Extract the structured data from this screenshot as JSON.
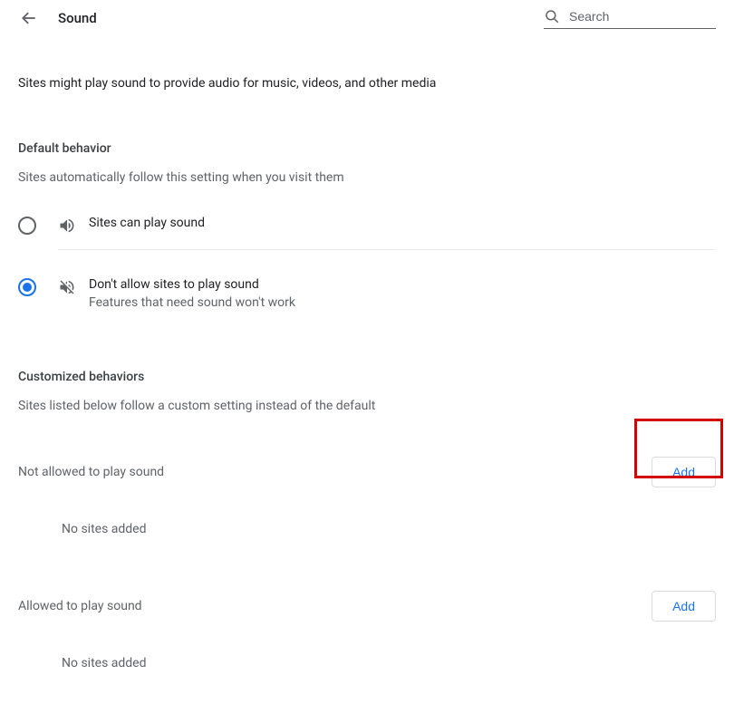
{
  "header": {
    "title": "Sound",
    "search_placeholder": "Search"
  },
  "intro": "Sites might play sound to provide audio for music, videos, and other media",
  "default_behavior": {
    "heading": "Default behavior",
    "sub": "Sites automatically follow this setting when you visit them",
    "options": [
      {
        "label": "Sites can play sound",
        "desc": "",
        "selected": false
      },
      {
        "label": "Don't allow sites to play sound",
        "desc": "Features that need sound won't work",
        "selected": true
      }
    ]
  },
  "customized": {
    "heading": "Customized behaviors",
    "sub": "Sites listed below follow a custom setting instead of the default",
    "groups": [
      {
        "label": "Not allowed to play sound",
        "add_label": "Add",
        "empty": "No sites added"
      },
      {
        "label": "Allowed to play sound",
        "add_label": "Add",
        "empty": "No sites added"
      }
    ]
  }
}
